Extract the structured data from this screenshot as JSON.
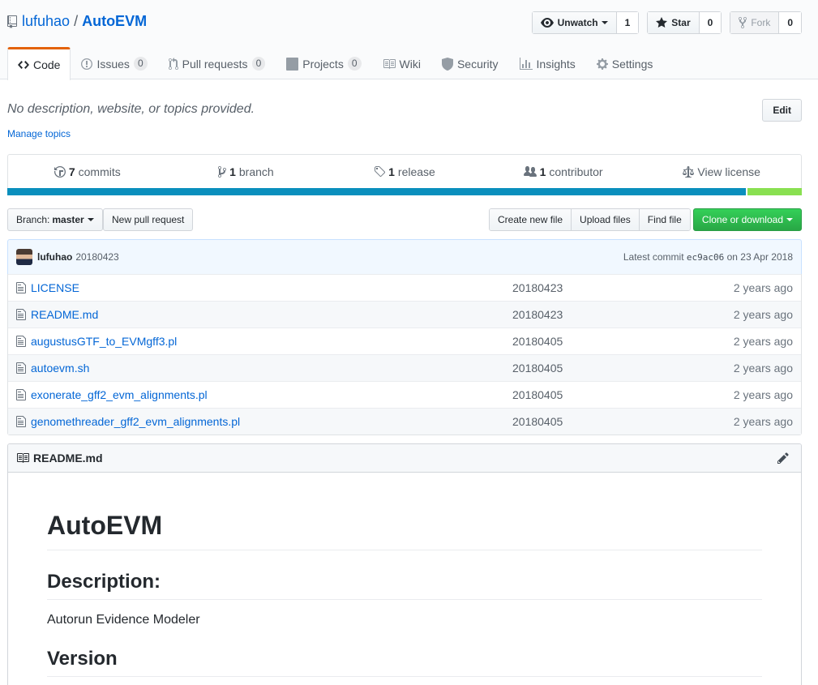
{
  "repo": {
    "owner": "lufuhao",
    "separator": "/",
    "name": "AutoEVM"
  },
  "actions": {
    "watch": {
      "label": "Unwatch",
      "count": "1"
    },
    "star": {
      "label": "Star",
      "count": "0"
    },
    "fork": {
      "label": "Fork",
      "count": "0"
    }
  },
  "nav": {
    "code": "Code",
    "issues": {
      "label": "Issues",
      "count": "0"
    },
    "pulls": {
      "label": "Pull requests",
      "count": "0"
    },
    "projects": {
      "label": "Projects",
      "count": "0"
    },
    "wiki": "Wiki",
    "security": "Security",
    "insights": "Insights",
    "settings": "Settings"
  },
  "description": "No description, website, or topics provided.",
  "manage_topics": "Manage topics",
  "edit_label": "Edit",
  "summary": {
    "commits": {
      "num": "7",
      "label": "commits"
    },
    "branch": {
      "num": "1",
      "label": "branch"
    },
    "release": {
      "num": "1",
      "label": "release"
    },
    "contributor": {
      "num": "1",
      "label": "contributor"
    },
    "license": "View license"
  },
  "languages": [
    {
      "color": "#0a8fbd",
      "share": 0.932
    },
    {
      "color": "#89e051",
      "share": 0.068
    }
  ],
  "file_nav": {
    "branch_prefix": "Branch:",
    "branch_name": "master",
    "new_pr": "New pull request",
    "create_file": "Create new file",
    "upload_files": "Upload files",
    "find_file": "Find file",
    "clone": "Clone or download"
  },
  "commit": {
    "author": "lufuhao",
    "message": "20180423",
    "latest_label": "Latest commit",
    "sha": "ec9ac06",
    "date": "on 23 Apr 2018"
  },
  "files": [
    {
      "name": "LICENSE",
      "message": "20180423",
      "age": "2 years ago"
    },
    {
      "name": "README.md",
      "message": "20180423",
      "age": "2 years ago"
    },
    {
      "name": "augustusGTF_to_EVMgff3.pl",
      "message": "20180405",
      "age": "2 years ago"
    },
    {
      "name": "autoevm.sh",
      "message": "20180405",
      "age": "2 years ago"
    },
    {
      "name": "exonerate_gff2_evm_alignments.pl",
      "message": "20180405",
      "age": "2 years ago"
    },
    {
      "name": "genomethreader_gff2_evm_alignments.pl",
      "message": "20180405",
      "age": "2 years ago"
    }
  ],
  "readme": {
    "filename": "README.md",
    "h1": "AutoEVM",
    "h2_description": "Description:",
    "description_text": "Autorun Evidence Modeler",
    "h2_version": "Version"
  }
}
